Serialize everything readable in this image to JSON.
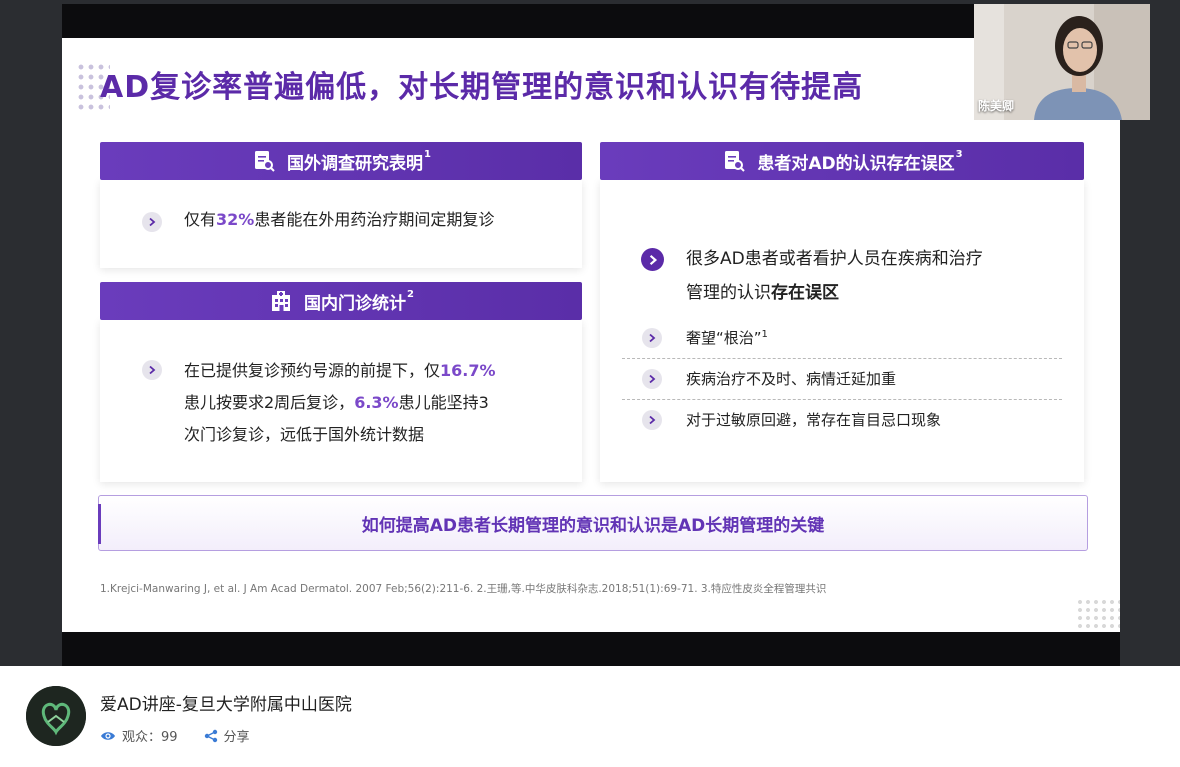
{
  "slide": {
    "title": "AD复诊率普遍偏低，对长期管理的意识和认识有待提高",
    "panel1": {
      "header": "国外调查研究表明",
      "header_sup": "1",
      "text_pre": "仅有",
      "text_hl": "32%",
      "text_post": "患者能在外用药治疗期间定期复诊"
    },
    "panel2": {
      "header": "国内门诊统计",
      "header_sup": "2",
      "line1_pre": "在已提供复诊预约号源的前提下，仅",
      "line1_hl": "16.7%",
      "line2_pre": "患儿按要求2周后复诊，",
      "line2_hl": "6.3%",
      "line2_post": "患儿能坚持3",
      "line3": "次门诊复诊，远低于国外统计数据"
    },
    "panel3": {
      "header": "患者对AD的认识存在误区",
      "header_sup": "3",
      "main_line1": "很多AD患者或者看护人员在疾病和治疗",
      "main_line2_pre": "管理的认识",
      "main_line2_bold": "存在误区",
      "items": [
        {
          "text": "奢望“根治”",
          "sup": "1"
        },
        {
          "text": "疾病治疗不及时、病情迁延加重",
          "sup": ""
        },
        {
          "text": "对于过敏原回避，常存在盲目忌口现象",
          "sup": ""
        }
      ]
    },
    "banner": "如何提高AD患者长期管理的意识和认识是AD长期管理的关键",
    "references": "1.Krejci-Manwaring J, et al. J Am Acad Dermatol. 2007 Feb;56(2):211-6. 2.王珊,等.中华皮肤科杂志.2018;51(1):69-71. 3.特应性皮炎全程管理共识"
  },
  "webcam": {
    "name": "陈美卿"
  },
  "channel": {
    "title": "爱AD讲座-复旦大学附属中山医院",
    "viewers_label": "观众：99",
    "share_label": "分享"
  },
  "colors": {
    "accent": "#5b2aa8",
    "highlight": "#7b49c9",
    "link_blue": "#3a7bd5"
  },
  "icons": {
    "panel1": "document-search-icon",
    "panel2": "hospital-icon",
    "panel3": "document-search-icon",
    "viewers": "eye-icon",
    "share": "share-icon"
  }
}
